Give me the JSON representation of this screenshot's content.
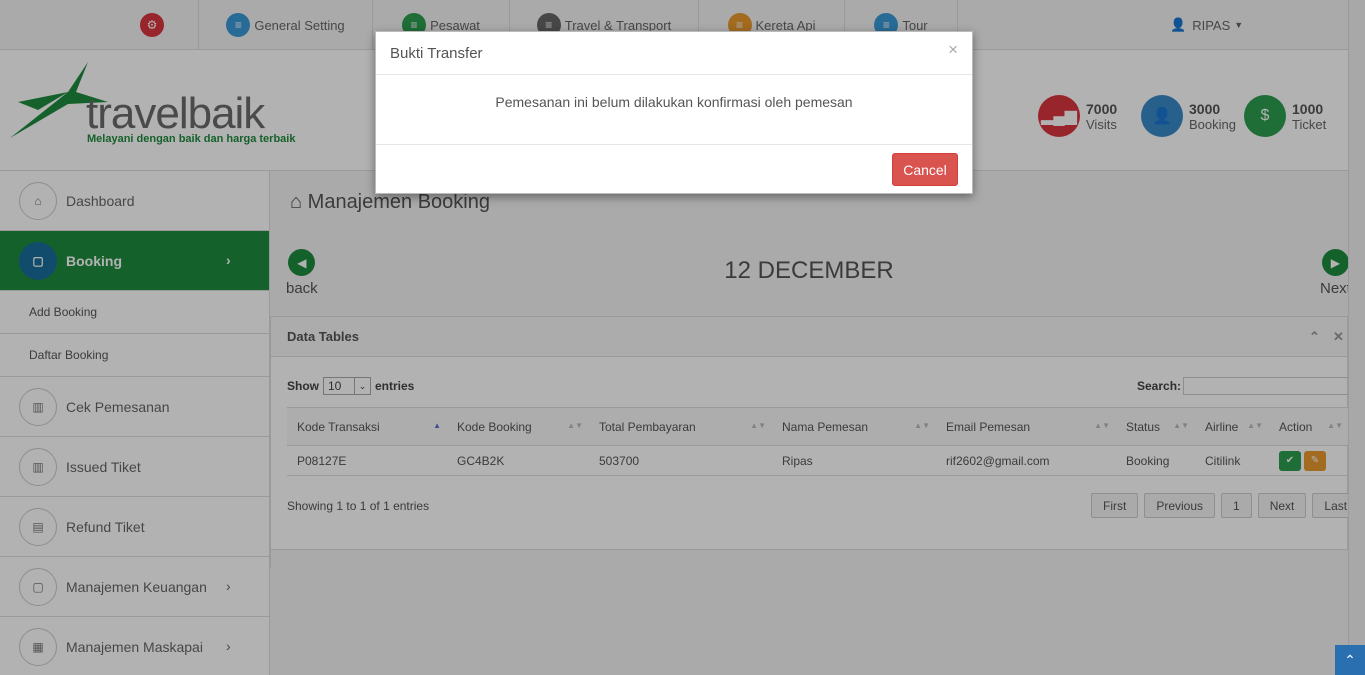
{
  "topnav": {
    "items": [
      {
        "label": "General Setting",
        "color": "#3a9ad9"
      },
      {
        "label": "Pesawat",
        "color": "#2d9d4f"
      },
      {
        "label": "Travel & Transport",
        "color": "#666666"
      },
      {
        "label": "Kereta Api",
        "color": "#e89a2e"
      },
      {
        "label": "Tour",
        "color": "#3a9ad9"
      }
    ],
    "user": "RIPAS"
  },
  "logo": {
    "name": "travelbaik",
    "tagline": "Melayani dengan baik dan harga terbaik"
  },
  "stats": [
    {
      "value": "7000",
      "label": "Visits",
      "color": "#d9363e"
    },
    {
      "value": "3000",
      "label": "Booking",
      "color": "#3a8ac9"
    },
    {
      "value": "1000",
      "label": "Ticket",
      "color": "#2d9d4f"
    }
  ],
  "sidebar": {
    "items": [
      {
        "label": "Dashboard",
        "icon": "home-icon"
      },
      {
        "label": "Booking",
        "icon": "file-icon",
        "active": true
      },
      {
        "label": "Cek Pemesanan",
        "icon": "chart-icon"
      },
      {
        "label": "Issued Tiket",
        "icon": "chart-icon"
      },
      {
        "label": "Refund Tiket",
        "icon": "card-icon"
      },
      {
        "label": "Manajemen Keuangan",
        "icon": "file-icon"
      },
      {
        "label": "Manajemen Maskapai",
        "icon": "grid-icon"
      }
    ],
    "subitems": [
      "Add Booking",
      "Daftar Booking"
    ]
  },
  "main": {
    "title": "Manajemen Booking",
    "date": "12 DECEMBER",
    "back": "back",
    "next": "Next"
  },
  "table": {
    "panel_title": "Data Tables",
    "show": "Show",
    "entries_value": "10",
    "entries": "entries",
    "search": "Search:",
    "columns": [
      "Kode Transaksi",
      "Kode Booking",
      "Total Pembayaran",
      "Nama Pemesan",
      "Email Pemesan",
      "Status",
      "Airline",
      "Action"
    ],
    "rows": [
      [
        "P08127E",
        "GC4B2K",
        "503700",
        "Ripas",
        "rif2602@gmail.com",
        "Booking",
        "Citilink"
      ]
    ],
    "info": "Showing 1 to 1 of 1 entries",
    "pagination": [
      "First",
      "Previous",
      "1",
      "Next",
      "Last"
    ]
  },
  "modal": {
    "title": "Bukti Transfer",
    "close": "×",
    "message": "Pemesanan ini belum dilakukan konfirmasi oleh pemesan",
    "cancel": "Cancel"
  }
}
